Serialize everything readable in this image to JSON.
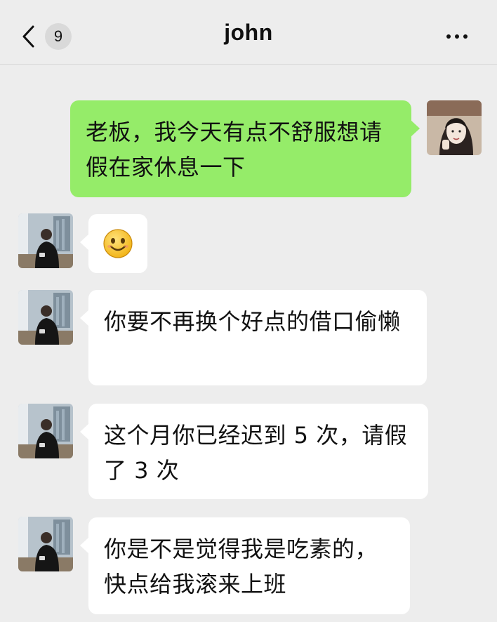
{
  "header": {
    "title": "john",
    "unread_count": "9",
    "back_icon": "chevron-left-icon",
    "more_icon": "more-dots-icon"
  },
  "colors": {
    "background": "#ededed",
    "self_bubble": "#95ec69",
    "other_bubble": "#ffffff"
  },
  "messages": [
    {
      "sender": "self",
      "text": "老板，我今天有点不舒服想请假在家休息一下"
    },
    {
      "sender": "other",
      "emoji": "smiley-face-icon",
      "text": ""
    },
    {
      "sender": "other",
      "text": "你要不再换个好点的借口偷懒"
    },
    {
      "sender": "other",
      "text": "这个月你已经迟到 5 次，请假了 3 次"
    },
    {
      "sender": "other",
      "text": "你是不是觉得我是吃素的，快点给我滚来上班"
    }
  ]
}
